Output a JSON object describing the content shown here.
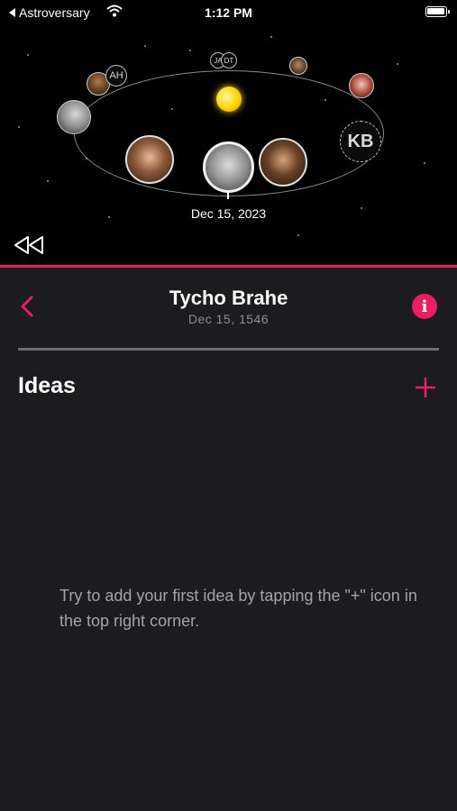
{
  "status_bar": {
    "back_app": "Astroversary",
    "time": "1:12 PM"
  },
  "orbit": {
    "date": "Dec 15, 2023",
    "badges": [
      "AH",
      "JA",
      "DT",
      "KB"
    ]
  },
  "detail": {
    "name": "Tycho Brahe",
    "birth_date": "Dec 15, 1546"
  },
  "ideas": {
    "section_title": "Ideas",
    "empty_message": "Try to add your first idea by tapping the \"+\" icon in the top right corner."
  },
  "colors": {
    "accent": "#e91e63",
    "background": "#1c1c1e",
    "top_panel": "#000000"
  }
}
